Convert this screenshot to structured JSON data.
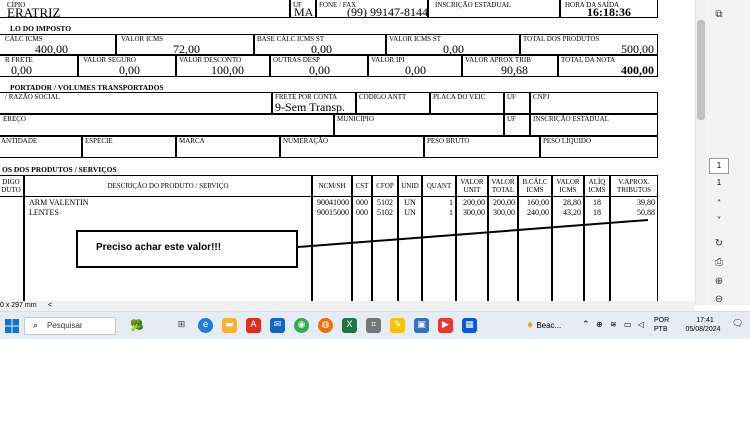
{
  "doc": {
    "header": {
      "municipio_label": "CÍPIO",
      "municipio_value": "ERATRIZ",
      "uf_label": "UF",
      "uf_value": "MA",
      "fone_label": "FONE / FAX",
      "fone_value": "(99) 99147-8144",
      "ie_label": "INSCRIÇÃO ESTADUAL",
      "hora_label": "HORA DA SAÍDA",
      "hora_value": "16:18:36"
    },
    "imposto": {
      "section_title": "LO DO IMPOSTO",
      "row1": [
        {
          "label": "CÁLC ICMS",
          "value": "400,00"
        },
        {
          "label": "VALOR ICMS",
          "value": "72,00"
        },
        {
          "label": "BASE CÁLC ICMS ST",
          "value": "0,00"
        },
        {
          "label": "VALOR ICMS ST",
          "value": "0,00"
        },
        {
          "label": "TOTAL DOS PRODUTOS",
          "value": "500,00"
        }
      ],
      "row2": [
        {
          "label": "R FRETE",
          "value": "0,00"
        },
        {
          "label": "VALOR SEGURO",
          "value": "0,00"
        },
        {
          "label": "VALOR DESCONTO",
          "value": "100,00"
        },
        {
          "label": "OUTRAS DESP",
          "value": "0,00"
        },
        {
          "label": "VALOR IPI",
          "value": "0,00"
        },
        {
          "label": "VALOR APROX TRIB",
          "value": "90,68"
        },
        {
          "label": "TOTAL DA NOTA",
          "value": "400,00"
        }
      ]
    },
    "transportador": {
      "section_title": "PORTADOR / VOLUMES TRANSPORTADOS",
      "razao_label": "/ RAZÃO SOCIAL",
      "frete_label": "FRETE POR CONTA",
      "frete_value": "9-Sem Transp.",
      "antt_label": "CÓDIGO ANTT",
      "placa_label": "PLACA DO VEIC",
      "uf_label": "UF",
      "cnpj_label": "CNPJ",
      "endereco_label": "EREÇO",
      "municipio_label": "MUNICÍPIO",
      "uf2_label": "UF",
      "ie_label": "INSCRIÇÃO ESTADUAL",
      "quantidade_label": "ANTIDADE",
      "especie_label": "ESPÉCIE",
      "marca_label": "MARCA",
      "numeracao_label": "NUMERAÇÃO",
      "peso_bruto_label": "PESO BRUTO",
      "peso_liquido_label": "PESO LÍQUIDO"
    },
    "produtos": {
      "section_title": "OS DOS PRODUTOS / SERVIÇOS",
      "columns": [
        "DIGO\nDUTO",
        "DESCRIÇÃO DO PRODUTO / SERVIÇO",
        "NCM/SH",
        "CST",
        "CFOP",
        "UNID",
        "QUANT",
        "VALOR\nUNIT",
        "VALOR\nTOTAL",
        "B.CÁLC\nICMS",
        "VALOR\nICMS",
        "ALÍQ\nICMS",
        "V.APROX.\nTRIBUTOS"
      ],
      "rows": [
        {
          "desc": "ARM VALENTIN",
          "ncm": "90041000",
          "cst": "000",
          "cfop": "5102",
          "unid": "UN",
          "quant": "1",
          "vunit": "200,00",
          "vtotal": "200,00",
          "bcalc": "160,00",
          "vicms": "28,80",
          "aliq": "18",
          "vaprox": "39,80"
        },
        {
          "desc": "LENTES",
          "ncm": "90015000",
          "cst": "000",
          "cfop": "5102",
          "unid": "UN",
          "quant": "1",
          "vunit": "300,00",
          "vtotal": "300,00",
          "bcalc": "240,00",
          "vicms": "43,20",
          "aliq": "18",
          "vaprox": "50,88"
        }
      ]
    },
    "annotation": "Preciso achar este valor!!!",
    "page_size": "0 x 297 mm"
  },
  "viewer": {
    "page_current": "1",
    "page_total": "1"
  },
  "taskbar": {
    "search_placeholder": "Pesquisar",
    "beac_label": "Beac...",
    "lang_top": "POR",
    "lang_bottom": "PTB",
    "time": "17:41",
    "date": "05/08/2024"
  },
  "colors": {
    "taskbar_bg": "#e6ecf3",
    "annotation_border": "#000000"
  }
}
